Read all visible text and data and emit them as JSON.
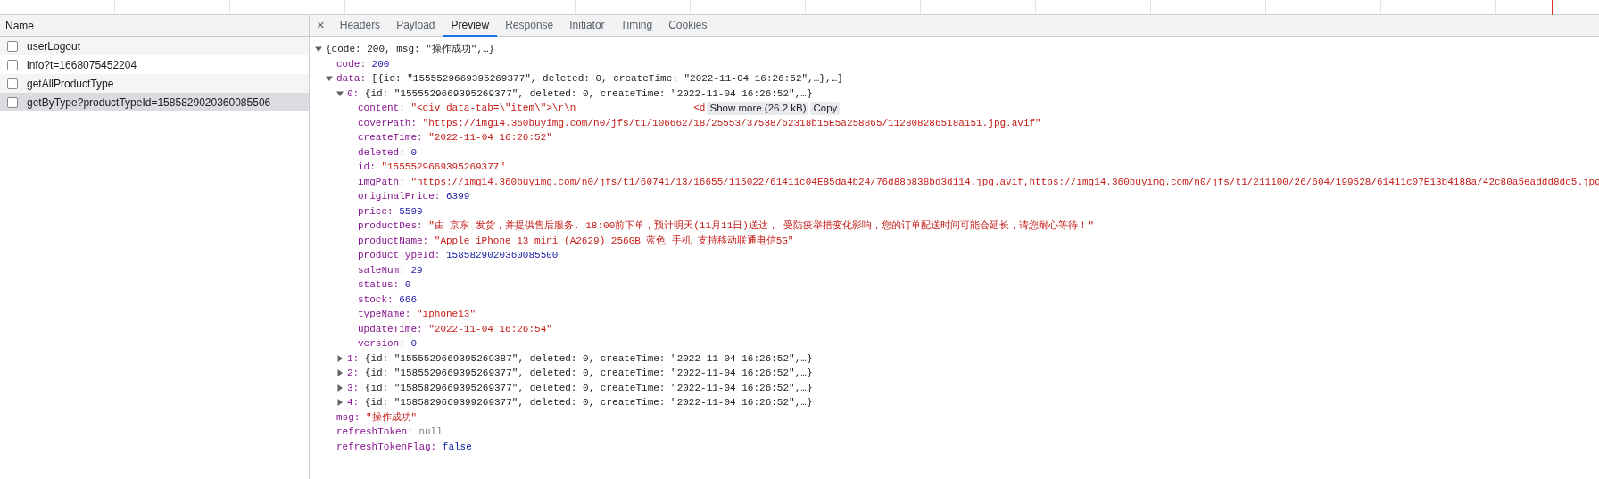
{
  "requests_header": "Name",
  "requests": [
    {
      "name": "userLogout",
      "selected": false
    },
    {
      "name": "info?t=1668075452204",
      "selected": false
    },
    {
      "name": "getAllProductType",
      "selected": false
    },
    {
      "name": "getByType?productTypeId=1585829020360085506",
      "selected": true
    }
  ],
  "detail_tabs": {
    "close": "×",
    "tabs": [
      {
        "label": "Headers",
        "selected": false
      },
      {
        "label": "Payload",
        "selected": false
      },
      {
        "label": "Preview",
        "selected": true
      },
      {
        "label": "Response",
        "selected": false
      },
      {
        "label": "Initiator",
        "selected": false
      },
      {
        "label": "Timing",
        "selected": false
      },
      {
        "label": "Cookies",
        "selected": false
      }
    ]
  },
  "preview": {
    "kind": "object",
    "summary": "{code: 200, msg: \"操作成功\",…}",
    "expanded": true,
    "children": [
      {
        "kind": "number",
        "key": "code:",
        "value": "200"
      },
      {
        "kind": "object",
        "key": "data:",
        "summary": "[{id: \"1555529669395269377\", deleted: 0, createTime: \"2022-11-04 16:26:52\",…},…]",
        "expanded": true,
        "children": [
          {
            "kind": "object",
            "key": "0:",
            "summary": "{id: \"1555529669395269377\", deleted: 0, createTime: \"2022-11-04 16:26:52\",…}",
            "expanded": true,
            "children": [
              {
                "kind": "string",
                "key": "content:",
                "value": "\"<div data-tab=\\\"item\\\">\\r\\n                    <d",
                "actions": [
                  "Show more (26.2 kB)",
                  "Copy"
                ]
              },
              {
                "kind": "string",
                "key": "coverPath:",
                "value": "\"https://img14.360buyimg.com/n0/jfs/t1/106662/18/25553/37538/62318b15E5a258865/112808286518a151.jpg.avif\""
              },
              {
                "kind": "string",
                "key": "createTime:",
                "value": "\"2022-11-04 16:26:52\""
              },
              {
                "kind": "number",
                "key": "deleted:",
                "value": "0"
              },
              {
                "kind": "string",
                "key": "id:",
                "value": "\"1555529669395269377\""
              },
              {
                "kind": "string",
                "key": "imgPath:",
                "value": "\"https://img14.360buyimg.com/n0/jfs/t1/60741/13/16655/115022/61411c04E85da4b24/76d88b838bd3d114.jpg.avif,https://img14.360buyimg.com/n0/jfs/t1/211100/26/604/199528/61411c07E13b4188a/42c80a5eaddd8dc5.jpg"
              },
              {
                "kind": "number",
                "key": "originalPrice:",
                "value": "6399"
              },
              {
                "kind": "number",
                "key": "price:",
                "value": "5599"
              },
              {
                "kind": "string",
                "key": "productDes:",
                "value": "\"由 京东 发货，并提供售后服务. 18:00前下单，预计明天(11月11日)送达， 受防疫举措变化影响，您的订单配送时间可能会延长，请您耐心等待！\""
              },
              {
                "kind": "string",
                "key": "productName:",
                "value": "\"Apple iPhone 13 mini (A2629) 256GB 蓝色 手机 支持移动联通电信5G\""
              },
              {
                "kind": "number",
                "key": "productTypeId:",
                "value": "1585829020360085500"
              },
              {
                "kind": "number",
                "key": "saleNum:",
                "value": "29"
              },
              {
                "kind": "number",
                "key": "status:",
                "value": "0"
              },
              {
                "kind": "number",
                "key": "stock:",
                "value": "666"
              },
              {
                "kind": "string",
                "key": "typeName:",
                "value": "\"iphone13\""
              },
              {
                "kind": "string",
                "key": "updateTime:",
                "value": "\"2022-11-04 16:26:54\""
              },
              {
                "kind": "number",
                "key": "version:",
                "value": "0"
              }
            ]
          },
          {
            "kind": "object",
            "key": "1:",
            "summary": "{id: \"1555529669395269387\", deleted: 0, createTime: \"2022-11-04 16:26:52\",…}",
            "expanded": false
          },
          {
            "kind": "object",
            "key": "2:",
            "summary": "{id: \"1585529669395269377\", deleted: 0, createTime: \"2022-11-04 16:26:52\",…}",
            "expanded": false
          },
          {
            "kind": "object",
            "key": "3:",
            "summary": "{id: \"1585829669395269377\", deleted: 0, createTime: \"2022-11-04 16:26:52\",…}",
            "expanded": false
          },
          {
            "kind": "object",
            "key": "4:",
            "summary": "{id: \"1585829669399269377\", deleted: 0, createTime: \"2022-11-04 16:26:52\",…}",
            "expanded": false
          }
        ]
      },
      {
        "kind": "string",
        "key": "msg:",
        "value": "\"操作成功\""
      },
      {
        "kind": "null",
        "key": "refreshToken:",
        "value": "null"
      },
      {
        "kind": "keyword",
        "key": "refreshTokenFlag:",
        "value": "false"
      }
    ]
  }
}
